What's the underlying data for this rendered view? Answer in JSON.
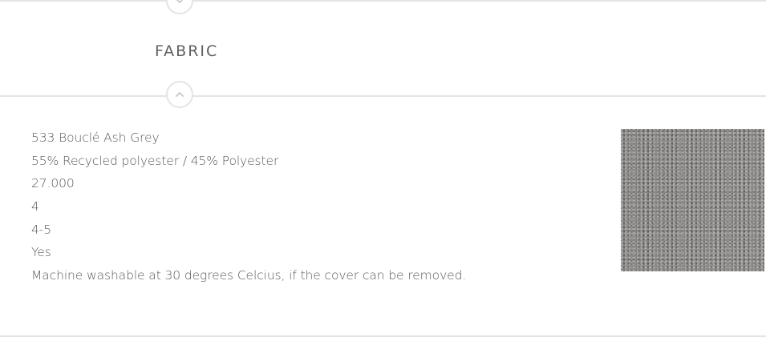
{
  "section": {
    "title": "FABRIC"
  },
  "fabric": {
    "specs": [
      "533 Bouclé Ash Grey",
      "55% Recycled polyester / 45% Polyester",
      "27.000",
      "4",
      "4-5",
      "Yes",
      "Machine washable at 30 degrees Celcius, if the cover can be removed."
    ],
    "swatch_color": "#8a8886"
  },
  "icons": {
    "previous": "chevron-down-icon",
    "collapse": "chevron-up-icon"
  }
}
